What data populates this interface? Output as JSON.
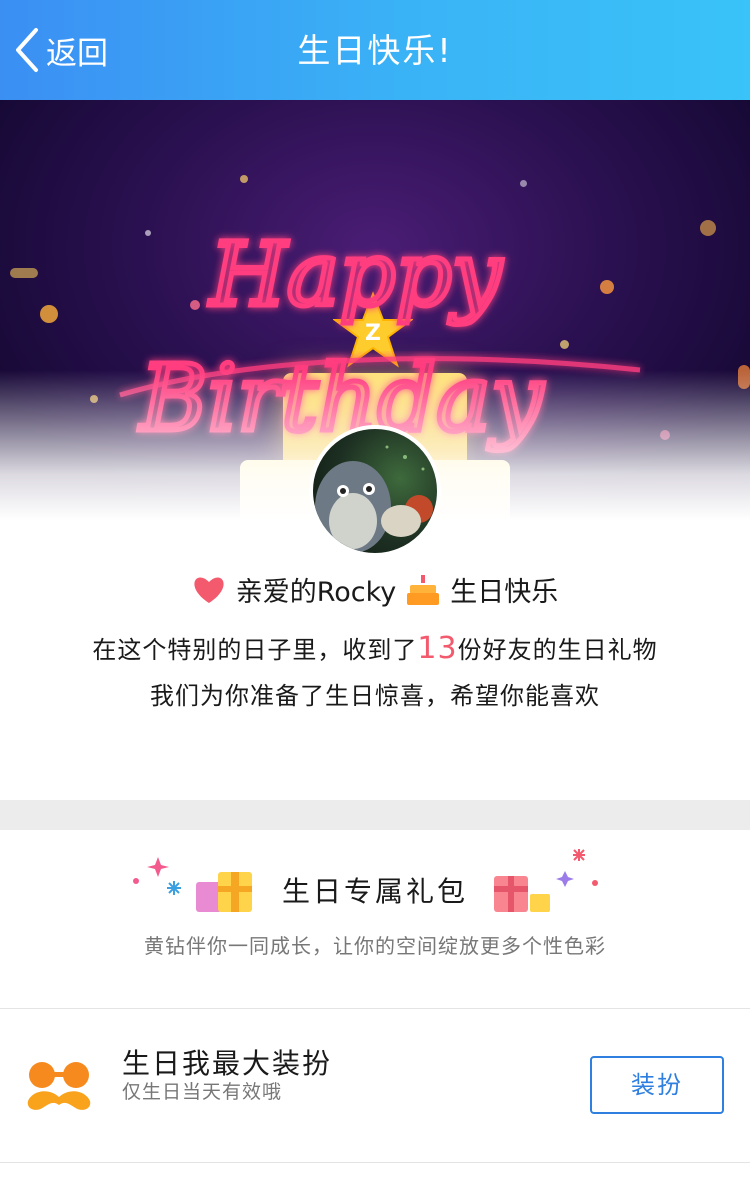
{
  "nav": {
    "back_label": "返回",
    "title": "生日快乐!"
  },
  "banner": {
    "script_text": "Happy Birthday"
  },
  "greeting": {
    "prefix": "亲爱的Rocky",
    "suffix": "生日快乐"
  },
  "message": {
    "line1_prefix": "在这个特别的日子里，收到了",
    "gift_count": "13",
    "line1_suffix": "份好友的生日礼物",
    "line2": "我们为你准备了生日惊喜，希望你能喜欢"
  },
  "gift_pack": {
    "title": "生日专属礼包",
    "subtitle": "黄钻伴你一同成长，让你的空间绽放更多个性色彩"
  },
  "dress_up": {
    "title": "生日我最大装扮",
    "subtitle": "仅生日当天有效哦",
    "button_label": "装扮"
  },
  "colors": {
    "nav_start": "#3b8ff3",
    "nav_end": "#39c3f8",
    "neon_pink": "#ff3d7f",
    "count_highlight": "#f35a6e",
    "button_blue": "#2f7fe0",
    "orange_accent": "#f68a1e"
  },
  "icons": [
    "chevron-left-icon",
    "heart-icon",
    "birthday-cake-icon",
    "gift-icon",
    "sparkle-icon",
    "mustache-glasses-icon"
  ]
}
